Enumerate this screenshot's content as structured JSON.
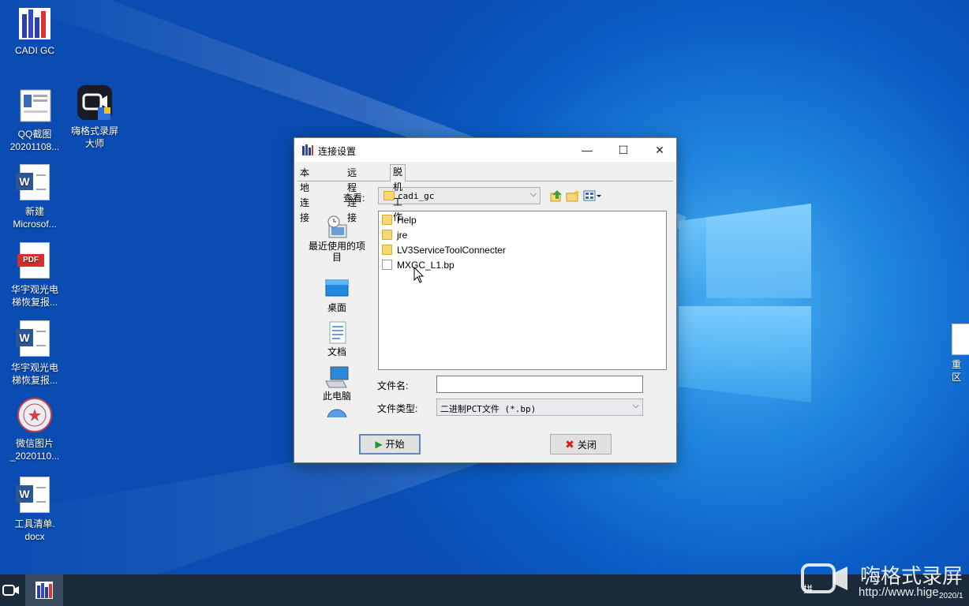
{
  "desktop": {
    "icons": [
      {
        "label": "CADI GC",
        "icon": "cadi-app-icon"
      },
      {
        "label": "QQ截图\n20201108...",
        "icon": "image-file-icon"
      },
      {
        "label": "嗨格式录屏\n大师",
        "icon": "screen-recorder-icon"
      },
      {
        "label": "新建\nMicrosof...",
        "icon": "word-doc-icon"
      },
      {
        "label": "华宇观光电\n梯恢复报...",
        "icon": "pdf-file-icon"
      },
      {
        "label": "华宇观光电\n梯恢复报...",
        "icon": "word-doc-icon"
      },
      {
        "label": "微信图片\n_2020110...",
        "icon": "stamp-image-icon"
      },
      {
        "label": "工具清单.\ndocx",
        "icon": "word-doc-icon"
      }
    ],
    "right_edge_fragment": "重\n区"
  },
  "dialog": {
    "title": "连接设置",
    "title_icon": "cadi-app-icon",
    "controls": {
      "minimize": "—",
      "maximize": "☐",
      "close": "✕"
    },
    "tabs": [
      {
        "label": "本地连接",
        "active": false
      },
      {
        "label": "远程连接",
        "active": false
      },
      {
        "label": "脱机工作",
        "active": true
      }
    ],
    "look_in_label": "查看:",
    "look_in_value": "cadi_gc",
    "toolbar_icons": [
      "up-folder-icon",
      "new-folder-icon",
      "view-menu-icon"
    ],
    "places": [
      {
        "label": "最近使用的项\n目",
        "icon": "recent-items-icon"
      },
      {
        "label": "桌面",
        "icon": "desktop-icon"
      },
      {
        "label": "文档",
        "icon": "documents-icon"
      },
      {
        "label": "此电脑",
        "icon": "this-pc-icon"
      },
      {
        "label": "",
        "icon": "network-icon"
      }
    ],
    "files": [
      {
        "name": "Help",
        "type": "folder"
      },
      {
        "name": "jre",
        "type": "folder"
      },
      {
        "name": "LV3ServiceToolConnecter",
        "type": "folder"
      },
      {
        "name": "MXGC_L1.bp",
        "type": "file"
      }
    ],
    "filename_label": "文件名:",
    "filename_value": "",
    "filetype_label": "文件类型:",
    "filetype_value": "二进制PCT文件 (*.bp)",
    "start_button": "开始",
    "close_button": "关闭"
  },
  "taskbar": {
    "items": [
      "screen-recorder-icon",
      "cadi-app-icon"
    ],
    "ime": "拼",
    "tray_text": "2020/1"
  },
  "watermark": {
    "brand": "嗨格式录屏",
    "url": "http://www.hige"
  },
  "colors": {
    "desktop_blue": "#0a5cc6",
    "taskbar": "#1b2a3a",
    "default_button_border": "#5b8ac6"
  }
}
